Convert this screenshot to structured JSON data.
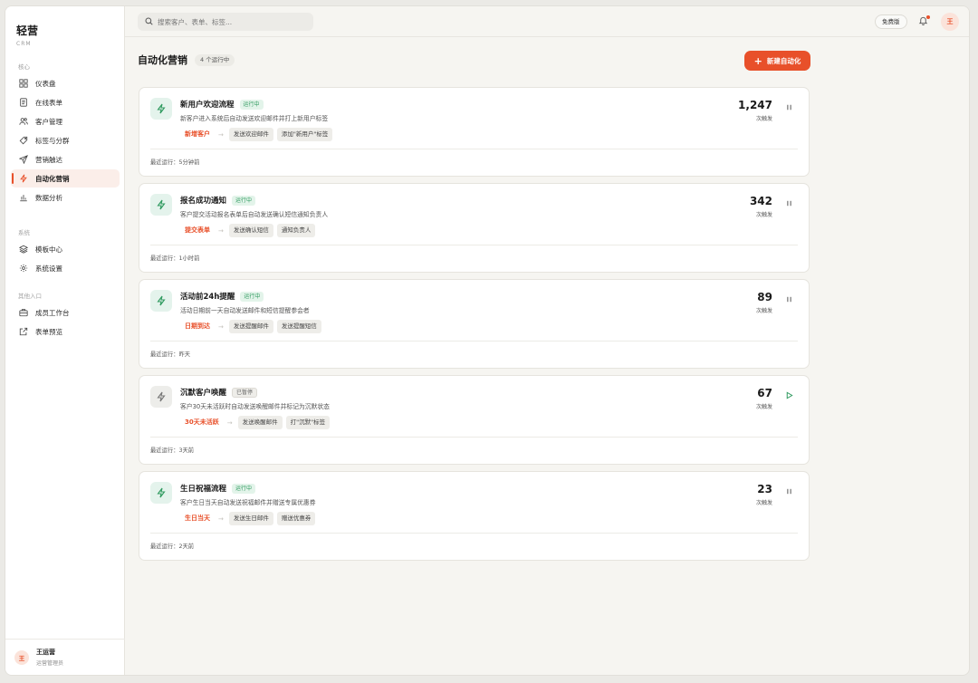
{
  "brand": {
    "title": "轻营",
    "subtitle": "CRM"
  },
  "sidebar": {
    "sections": [
      {
        "heading": "核心",
        "items": [
          {
            "label": "仪表盘",
            "icon": "dashboard-icon"
          },
          {
            "label": "在线表单",
            "icon": "form-icon"
          },
          {
            "label": "客户管理",
            "icon": "users-icon"
          },
          {
            "label": "标签与分群",
            "icon": "tag-icon"
          },
          {
            "label": "营销触达",
            "icon": "send-icon"
          },
          {
            "label": "自动化营销",
            "icon": "bolt-icon",
            "active": true
          },
          {
            "label": "数据分析",
            "icon": "chart-icon"
          }
        ]
      },
      {
        "heading": "系统",
        "items": [
          {
            "label": "模板中心",
            "icon": "layers-icon"
          },
          {
            "label": "系统设置",
            "icon": "gear-icon"
          }
        ]
      },
      {
        "heading": "其他入口",
        "items": [
          {
            "label": "成员工作台",
            "icon": "briefcase-icon"
          },
          {
            "label": "表单预览",
            "icon": "external-link-icon"
          }
        ]
      }
    ],
    "user": {
      "avatar": "王",
      "name": "王运营",
      "role": "运营管理员"
    }
  },
  "topbar": {
    "search_placeholder": "搜索客户、表单、标签...",
    "plan": "免费版",
    "avatar": "王"
  },
  "main": {
    "title": "自动化营销",
    "running_count": "4 个运行中",
    "new_button": "新建自动化",
    "count_unit": "次触发",
    "last_run_prefix": "最近运行：",
    "cards": [
      {
        "title": "新用户欢迎流程",
        "status": "运行中",
        "state": "running",
        "desc": "新客户进入系统后自动发送欢迎邮件并打上新用户标签",
        "trigger": "新增客户",
        "actions": [
          "发送欢迎邮件",
          "添加\"新用户\"标签"
        ],
        "count": "1,247",
        "last_run": "5分钟前"
      },
      {
        "title": "报名成功通知",
        "status": "运行中",
        "state": "running",
        "desc": "客户提交活动报名表单后自动发送确认短信通知负责人",
        "trigger": "提交表单",
        "actions": [
          "发送确认短信",
          "通知负责人"
        ],
        "count": "342",
        "last_run": "1小时前"
      },
      {
        "title": "活动前24h提醒",
        "status": "运行中",
        "state": "running",
        "desc": "活动日期前一天自动发送邮件和短信提醒参会者",
        "trigger": "日期到达",
        "actions": [
          "发送提醒邮件",
          "发送提醒短信"
        ],
        "count": "89",
        "last_run": "昨天"
      },
      {
        "title": "沉默客户唤醒",
        "status": "已暂停",
        "state": "paused",
        "desc": "客户30天未活跃时自动发送唤醒邮件并标记为沉默状态",
        "trigger": "30天未活跃",
        "actions": [
          "发送唤醒邮件",
          "打\"沉默\"标签"
        ],
        "count": "67",
        "last_run": "3天前"
      },
      {
        "title": "生日祝福流程",
        "status": "运行中",
        "state": "running",
        "desc": "客户生日当天自动发送祝福邮件并赠送专属优惠券",
        "trigger": "生日当天",
        "actions": [
          "发送生日邮件",
          "赠送优惠券"
        ],
        "count": "23",
        "last_run": "2天前"
      }
    ]
  },
  "colors": {
    "accent": "#e8502a",
    "running_green": "#2f9a5f"
  }
}
